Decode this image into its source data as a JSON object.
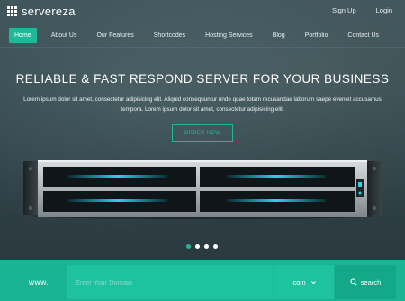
{
  "brand": {
    "name": "servereza"
  },
  "toplinks": {
    "signup": "Sign Up",
    "login": "Login"
  },
  "nav": {
    "items": [
      {
        "label": "Home"
      },
      {
        "label": "About Us"
      },
      {
        "label": "Our Features"
      },
      {
        "label": "Shortcodes"
      },
      {
        "label": "Hosting Services"
      },
      {
        "label": "Blog"
      },
      {
        "label": "Portfolio"
      },
      {
        "label": "Contact Us"
      }
    ],
    "active_index": 0
  },
  "hero": {
    "headline": "RELIABLE & FAST RESPOND SERVER FOR YOUR BUSINESS",
    "subtext": "Lorem ipsum dolor sit amet, consectetur adipisicing elit. Aliquid consequuntur unde quae totam recusandae laborum saepe eveniet accusamus tempora. Lorem ipsum dolor sit amet, consectetur adipisicing elit.",
    "cta": "ORDER NOW"
  },
  "carousel": {
    "count": 4,
    "active_index": 0
  },
  "domain_search": {
    "prefix": "www.",
    "placeholder": "Enter Your Domain",
    "tld": ".com",
    "button": "search"
  },
  "colors": {
    "accent": "#1fb99a",
    "bar": "#1ab394",
    "bar_button": "#12a888",
    "hero_bg": "#33464b"
  },
  "icons": {
    "logo": "grid-icon",
    "tld": "chevron-down-icon",
    "search": "search-icon"
  }
}
